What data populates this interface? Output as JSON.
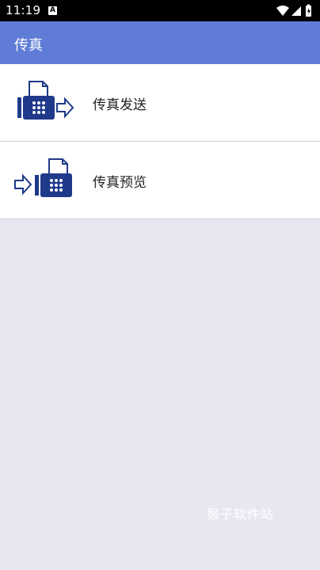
{
  "status_bar": {
    "time": "11:19",
    "notification_badge": "A",
    "icons": [
      "wifi-icon",
      "signal-icon",
      "battery-icon"
    ]
  },
  "app_bar": {
    "title": "传真"
  },
  "menu": {
    "items": [
      {
        "label": "传真发送",
        "icon": "fax-send-icon"
      },
      {
        "label": "传真预览",
        "icon": "fax-preview-icon"
      }
    ]
  },
  "watermark": "猴子软件站",
  "colors": {
    "app_bar": "#5f7cd6",
    "icon_blue": "#1f3a8a",
    "background": "#e6e7f1"
  }
}
